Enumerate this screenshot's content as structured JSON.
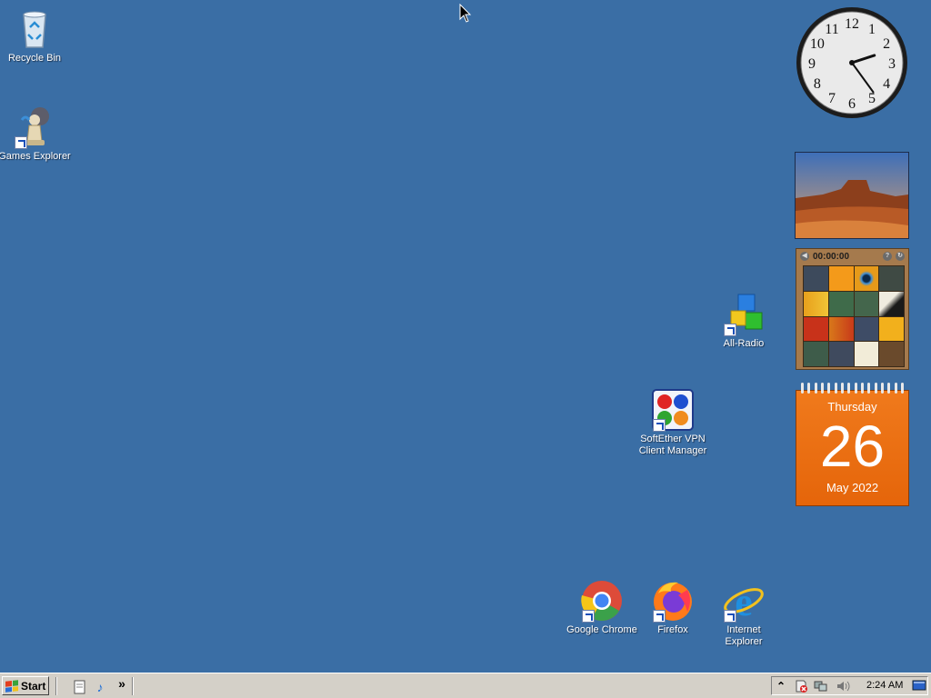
{
  "desktop": {
    "icons": [
      {
        "label": "Recycle Bin"
      },
      {
        "label": "Games Explorer"
      },
      {
        "label": "All-Radio"
      },
      {
        "label": "SoftEther VPN Client Manager"
      },
      {
        "label": "Google Chrome"
      },
      {
        "label": "Firefox"
      },
      {
        "label": "Internet Explorer"
      }
    ]
  },
  "gadgets": {
    "clock": {
      "time": "2:24",
      "numerals": [
        "12",
        "1",
        "2",
        "3",
        "4",
        "5",
        "6",
        "7",
        "8",
        "9",
        "10",
        "11"
      ]
    },
    "puzzle": {
      "timer": "00:00:00",
      "help": "?",
      "shuffle": "↻"
    },
    "calendar": {
      "weekday": "Thursday",
      "day": "26",
      "month_year": "May 2022"
    }
  },
  "taskbar": {
    "start_label": "Start",
    "quick_launch_more": "»",
    "tray_expand": "⌃",
    "time": "2:24 AM"
  },
  "colors": {
    "desktop": "#3a6ea5",
    "taskbar": "#d4d0c8",
    "calendar": "#e5650a"
  }
}
